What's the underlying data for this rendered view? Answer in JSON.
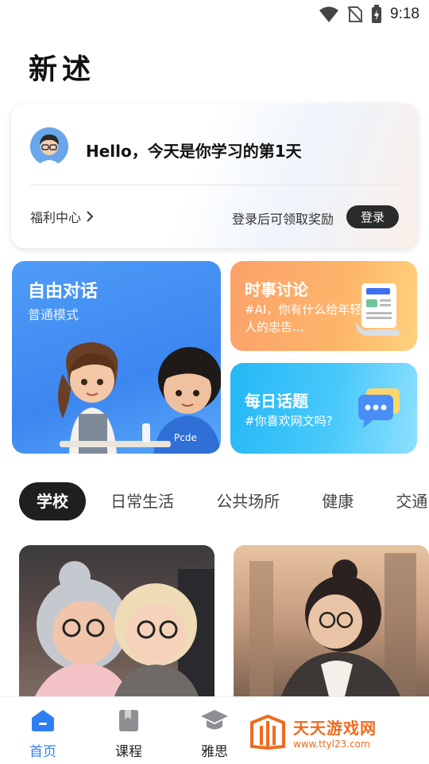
{
  "status_bar": {
    "time": "9:18"
  },
  "app": {
    "title": "新述"
  },
  "hello_card": {
    "greeting": "Hello，今天是你学习的第1天",
    "welfare_label": "福利中心",
    "reward_text": "登录后可领取奖励",
    "login_label": "登录"
  },
  "cards": {
    "free_talk": {
      "title": "自由对话",
      "subtitle": "普通模式"
    },
    "news": {
      "title": "时事讨论",
      "subtitle": "#AI，你有什么给年轻人的忠告…"
    },
    "daily_topic": {
      "title": "每日话题",
      "subtitle": "#你喜欢网文吗?"
    }
  },
  "tabs": [
    "学校",
    "日常生活",
    "公共场所",
    "健康",
    "交通出行"
  ],
  "bottom_nav": [
    {
      "label": "首页",
      "icon": "home-icon",
      "active": true
    },
    {
      "label": "课程",
      "icon": "book-icon",
      "active": false
    },
    {
      "label": "雅思",
      "icon": "graduation-cap-icon",
      "active": false
    }
  ],
  "watermark": {
    "title": "天天游戏网",
    "url": "www.ttyl23.com"
  },
  "colors": {
    "accent": "#2f7ff2",
    "free_card": "#3c86f0",
    "news_card": "#fba26a",
    "topic_card": "#25b8f5"
  }
}
